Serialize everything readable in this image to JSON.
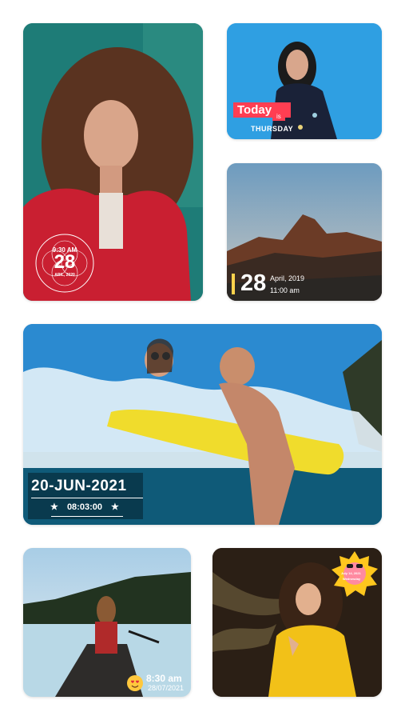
{
  "widgets": {
    "curly": {
      "time": "9:30 AM",
      "day": "28",
      "month_year": "ARIL, 2020"
    },
    "today": {
      "word": "Today",
      "is": "is",
      "weekday": "THURSDAY"
    },
    "mountain": {
      "day": "28",
      "month_year": "April, 2019",
      "time": "11:00 am"
    },
    "pool": {
      "date": "20-JUN-2021",
      "time": "08:03:00",
      "star": "★"
    },
    "lake": {
      "time": "8:30 am",
      "date": "28/07/2021",
      "emoji": "smiling-heart-eyes"
    },
    "sun": {
      "line1": "July 14, 2021",
      "line2": "Wednesday"
    }
  },
  "colors": {
    "accent_red": "#ff3e52",
    "accent_yellow": "#ffd34d"
  }
}
